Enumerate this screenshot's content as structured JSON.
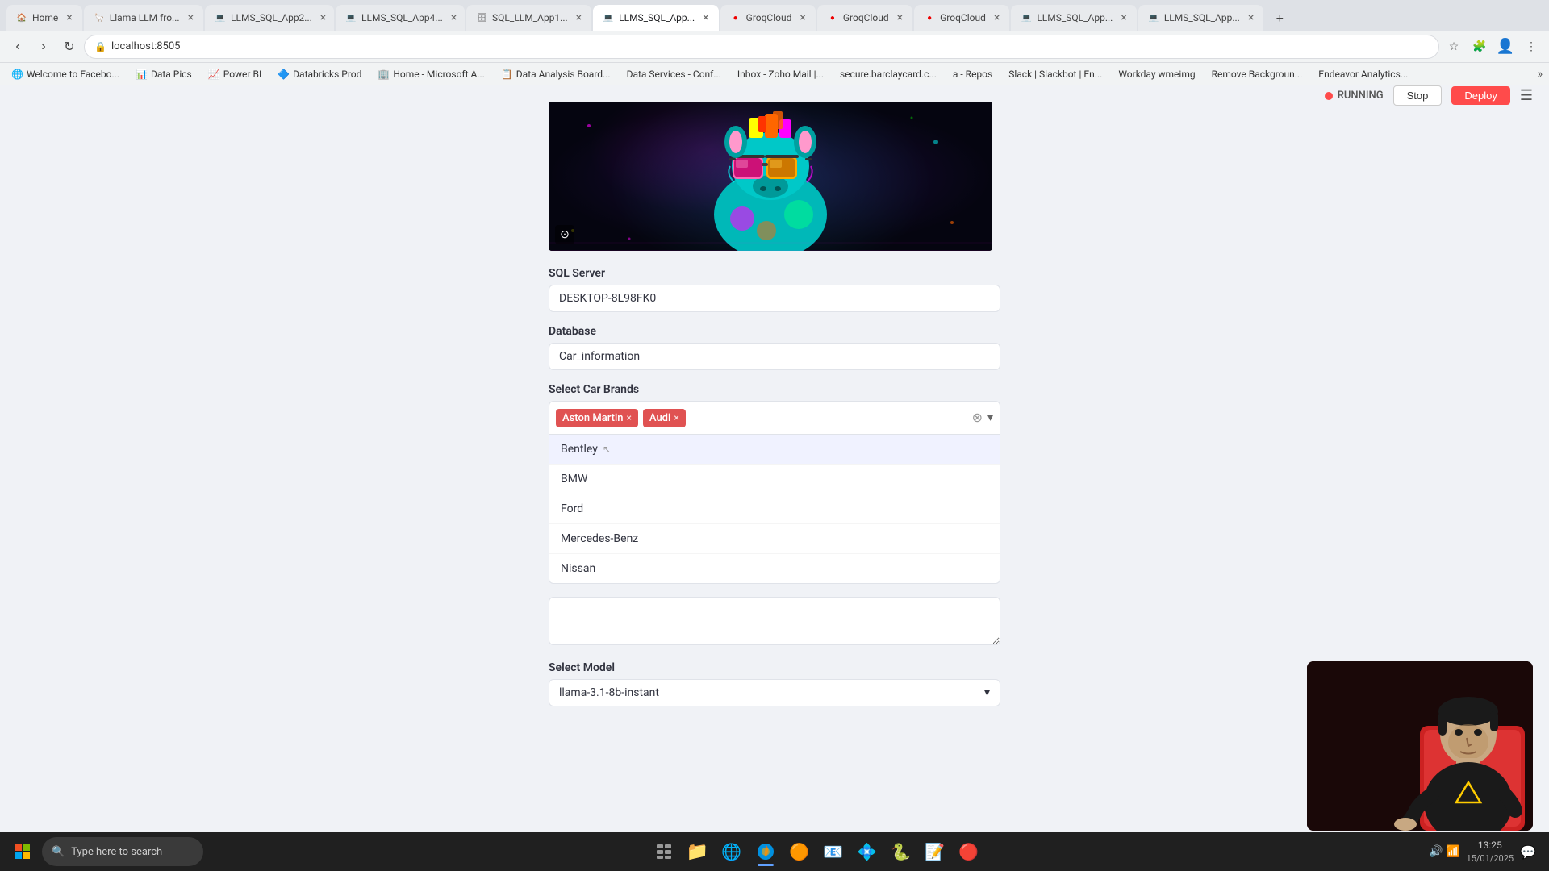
{
  "browser": {
    "tabs": [
      {
        "id": "tab1",
        "label": "Home",
        "active": false,
        "favicon": "🏠"
      },
      {
        "id": "tab2",
        "label": "Llama LLM fro...",
        "active": false,
        "favicon": "🦙"
      },
      {
        "id": "tab3",
        "label": "LLMS_SQL_App2...",
        "active": false,
        "favicon": "💻"
      },
      {
        "id": "tab4",
        "label": "LLMS_SQL_App4...",
        "active": false,
        "favicon": "💻"
      },
      {
        "id": "tab5",
        "label": "SQL_LLM_App1...",
        "active": false,
        "favicon": "🗄"
      },
      {
        "id": "tab6",
        "label": "LLMS_SQL_App...",
        "active": true,
        "favicon": "💻"
      },
      {
        "id": "tab7",
        "label": "GroqCloud",
        "active": false,
        "favicon": "🔴"
      },
      {
        "id": "tab8",
        "label": "GroqCloud",
        "active": false,
        "favicon": "🔴"
      },
      {
        "id": "tab9",
        "label": "GroqCloud",
        "active": false,
        "favicon": "🔴"
      },
      {
        "id": "tab10",
        "label": "LLMS_SQL_App...",
        "active": false,
        "favicon": "💻"
      },
      {
        "id": "tab11",
        "label": "LLMS_SQL_App...",
        "active": false,
        "favicon": "💻"
      }
    ],
    "address": "localhost:8505"
  },
  "bookmarks": [
    "Welcome to Facebo...",
    "Data Pics",
    "Power BI",
    "Databricks Prod",
    "Home - Microsoft A...",
    "Data Analysis Board...",
    "Data Services - Conf...",
    "Inbox - Zoho Mail |...",
    "secure.barclaycard.c...",
    "a - Repos",
    "Slack | Slackbot | En...",
    "Workday wmeimg",
    "Remove Backgroun...",
    "Endeavor Analytics..."
  ],
  "streamlit": {
    "running_label": "RUNNING",
    "stop_label": "Stop",
    "deploy_label": "Deploy"
  },
  "app": {
    "sql_server_label": "SQL Server",
    "sql_server_value": "DESKTOP-8L98FK0",
    "database_label": "Database",
    "database_value": "Car_information",
    "select_brands_label": "Select Car Brands",
    "selected_tags": [
      {
        "label": "Aston Martin",
        "color": "red"
      },
      {
        "label": "Audi",
        "color": "red"
      }
    ],
    "dropdown_items": [
      {
        "label": "Bentley",
        "hovered": true
      },
      {
        "label": "BMW",
        "hovered": false
      },
      {
        "label": "Ford",
        "hovered": false
      },
      {
        "label": "Mercedes-Benz",
        "hovered": false
      },
      {
        "label": "Nissan",
        "hovered": false
      }
    ],
    "select_model_label": "Select Model",
    "selected_model": "llama-3.1-8b-instant"
  },
  "taskbar": {
    "search_placeholder": "Type here to search",
    "time": "13:25",
    "date": "15/01/2025"
  }
}
